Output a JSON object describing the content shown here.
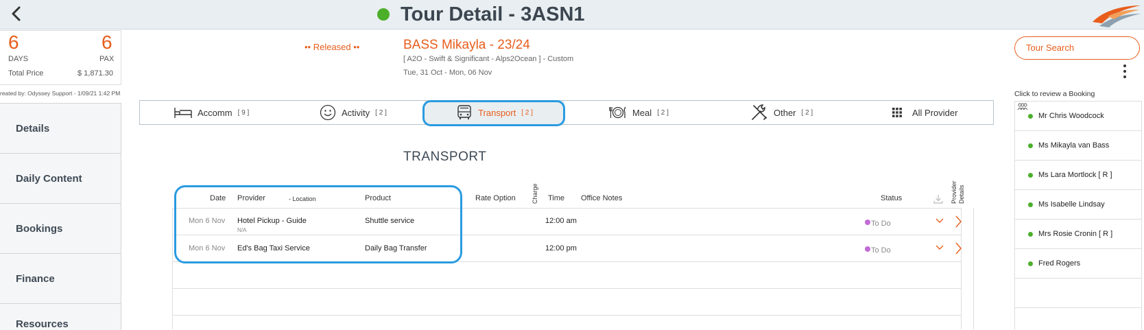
{
  "header": {
    "title": "Tour Detail - 3ASN1",
    "status_color": "#4caf2a"
  },
  "summary": {
    "days": "6",
    "days_label": "DAYS",
    "pax": "6",
    "pax_label": "PAX",
    "total_price_label": "Total Price",
    "total_price": "$ 1,871.30",
    "created_by": "reated by: Odyssey Support - 1/09/21 1:42 PM"
  },
  "sidebar": {
    "items": [
      "Details",
      "Daily Content",
      "Bookings",
      "Finance",
      "Resources"
    ]
  },
  "booking": {
    "status": "•• Released ••",
    "name": "BASS Mikayla - 23/24",
    "subtitle": "[ A2O - Swift & Significant - Alps2Ocean ] - Custom",
    "dates": "Tue, 31 Oct  - Mon, 06 Nov"
  },
  "tour_search": "Tour Search",
  "tabs": [
    {
      "label": "Accomm",
      "count": "[ 9 ]",
      "icon": "bed-icon"
    },
    {
      "label": "Activity",
      "count": "[ 2 ]",
      "icon": "smiley-icon"
    },
    {
      "label": "Transport",
      "count": "[ 2 ]",
      "icon": "bus-icon",
      "active": true
    },
    {
      "label": "Meal",
      "count": "[ 2 ]",
      "icon": "plate-cutlery-icon"
    },
    {
      "label": "Other",
      "count": "[ 2 ]",
      "icon": "tools-icon"
    },
    {
      "label": "All Provider",
      "count": "",
      "icon": "grid-icon"
    }
  ],
  "section_title": "TRANSPORT",
  "table": {
    "headers": {
      "date": "Date",
      "provider": "Provider",
      "location": "- Location",
      "product": "Product",
      "rate_option": "Rate Option",
      "charge": "Charge",
      "time": "Time",
      "office_notes": "Office Notes",
      "status": "Status",
      "provider_details_1": "Provider",
      "provider_details_2": "Details"
    },
    "rows": [
      {
        "date": "Mon 6 Nov",
        "provider": "Hotel Pickup - Guide",
        "location": "N/A",
        "product": "Shuttle service",
        "time": "12:00 am",
        "status": "To Do"
      },
      {
        "date": "Mon 6 Nov",
        "provider": "Ed's Bag Taxi Service",
        "location": "",
        "product": "Daily Bag Transfer",
        "time": "12:00 pm",
        "status": "To Do"
      }
    ]
  },
  "right_panel": {
    "caption": "Click to review a Booking",
    "passengers": [
      "Mr Chris Woodcock",
      "Ms Mikayla van Bass",
      "Ms Lara Mortlock  [ R ]",
      "Ms Isabelle Lindsay",
      "Mrs Rosie Cronin  [ R ]",
      "Fred Rogers"
    ]
  }
}
